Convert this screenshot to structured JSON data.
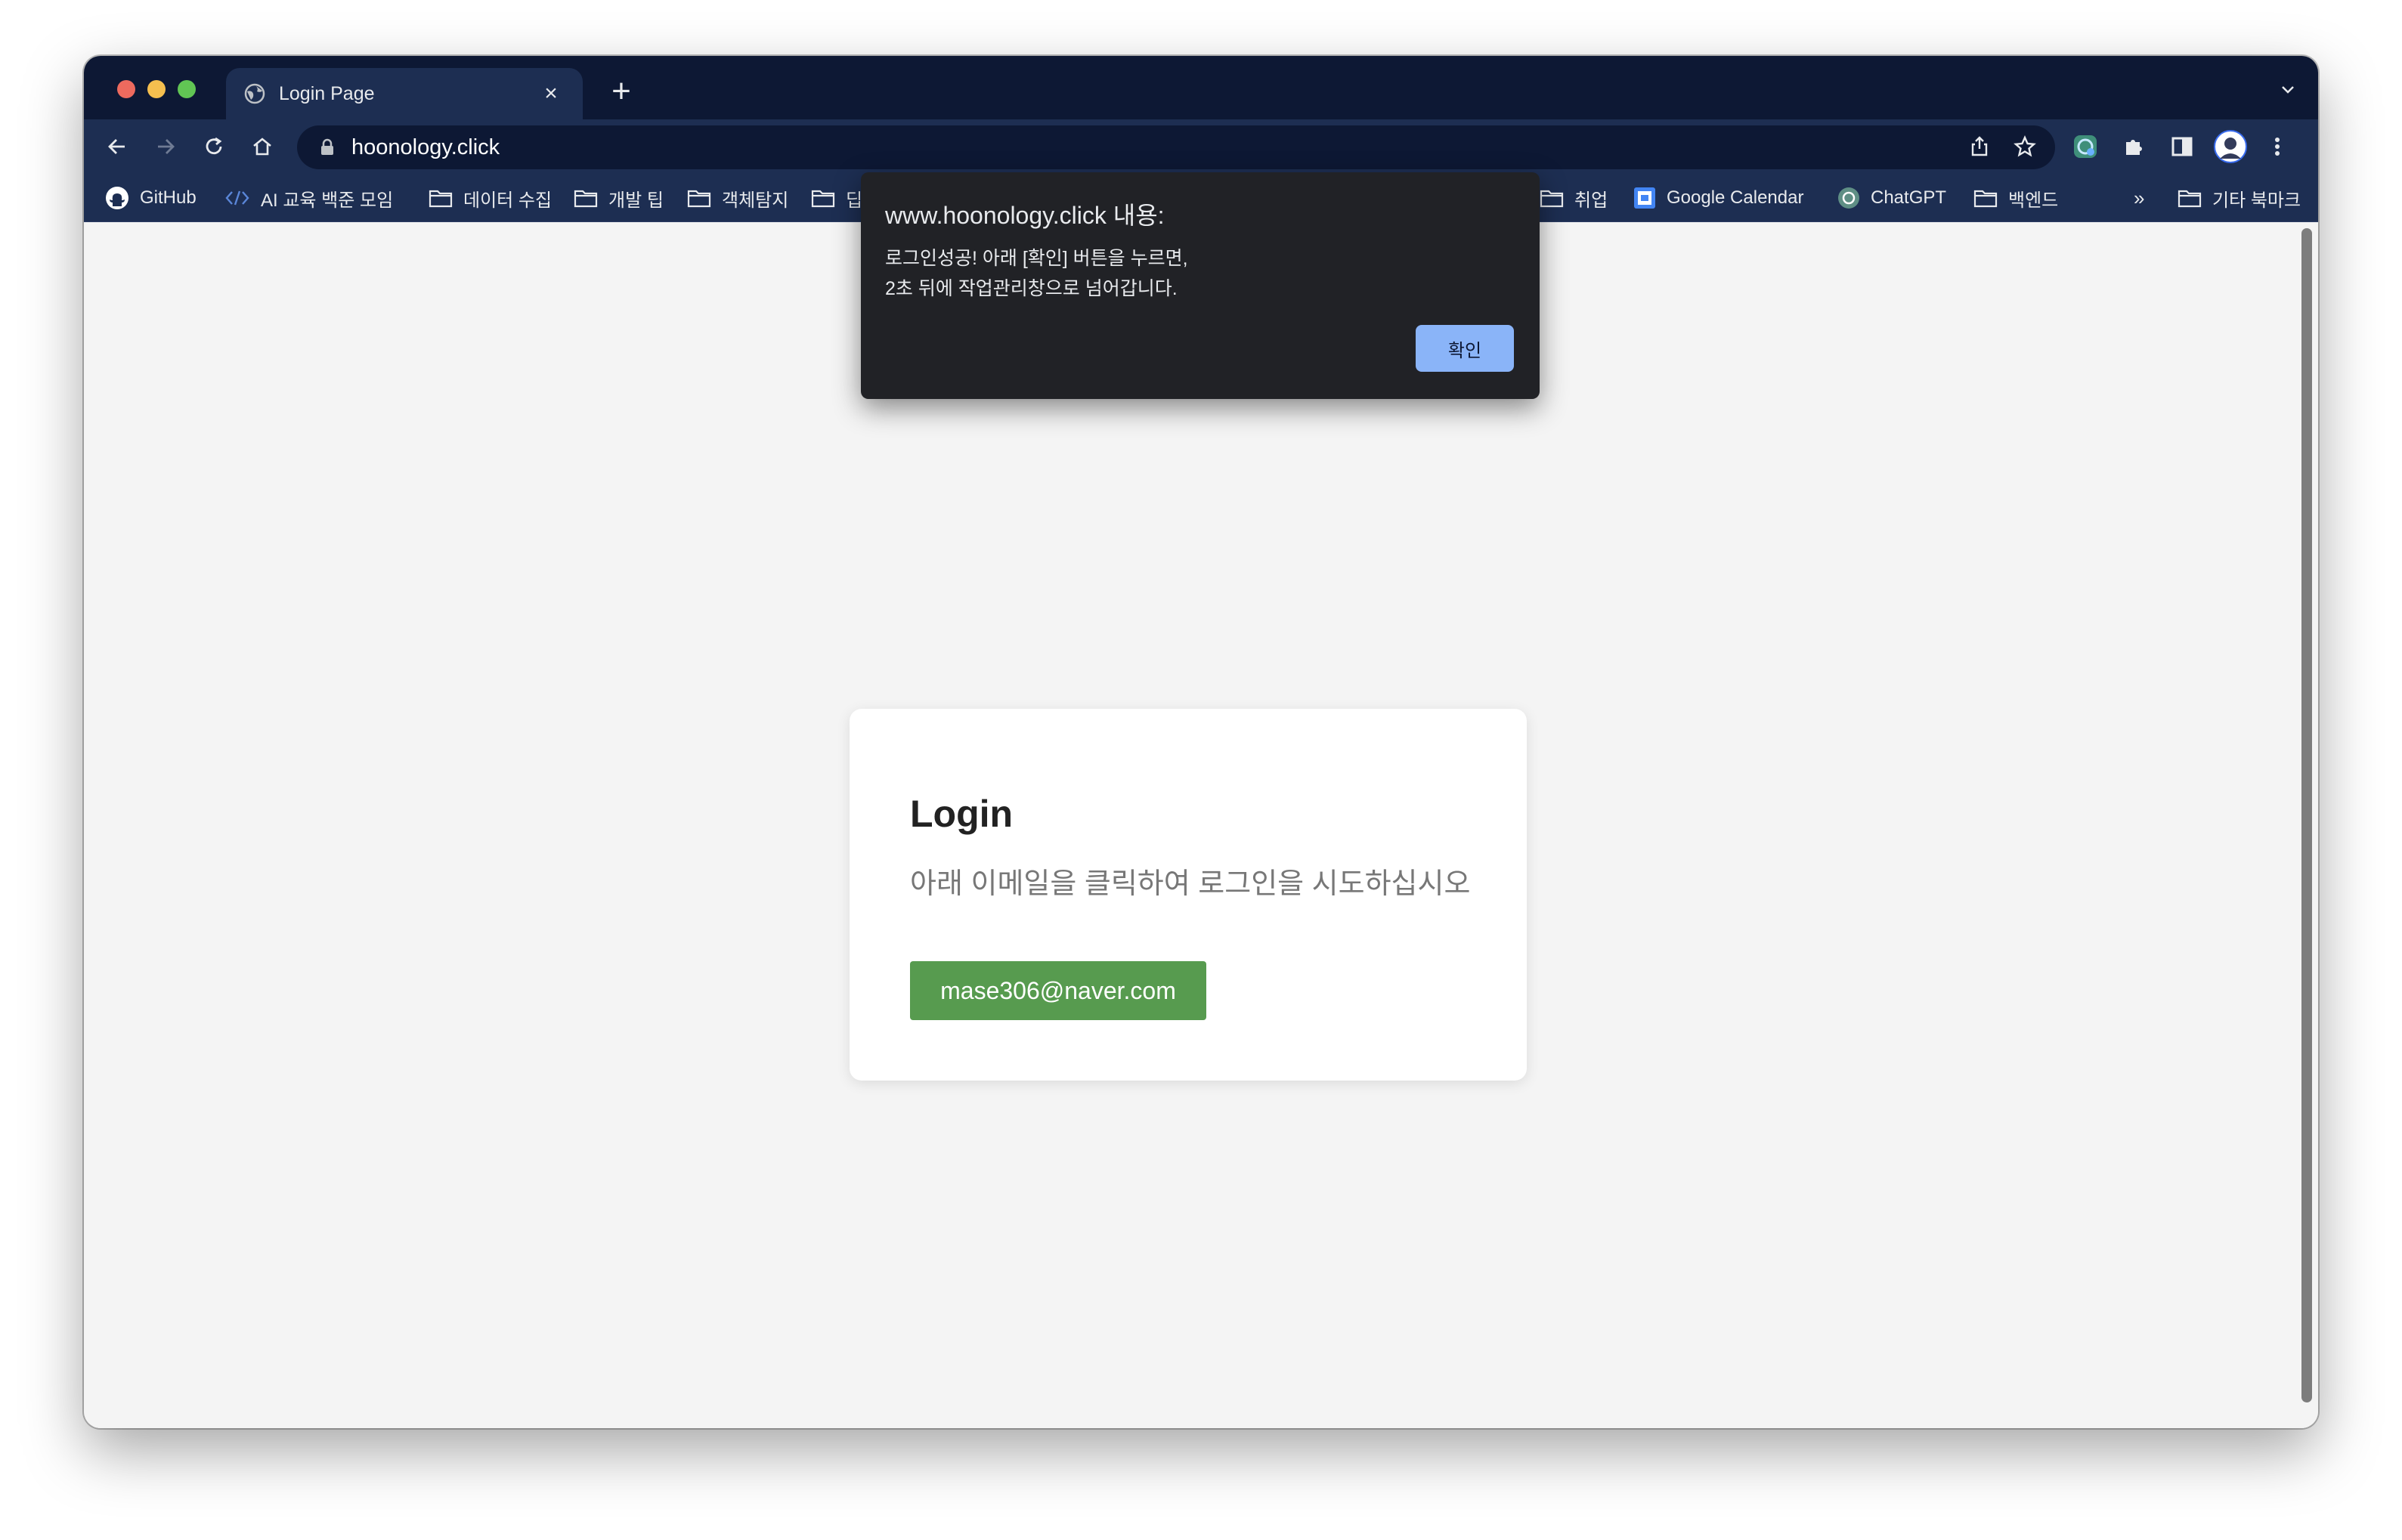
{
  "browser": {
    "tab": {
      "title": "Login Page",
      "close_glyph": "×",
      "icon": "globe-icon"
    },
    "new_tab_glyph": "+",
    "address": {
      "url": "hoonology.click",
      "icon": "lock-icon"
    },
    "overflow_glyph": "»",
    "bookmarks": [
      {
        "label": "GitHub",
        "icon": "github-icon"
      },
      {
        "label": "AI 교육 백준 모임 ",
        "icon": "code-icon"
      },
      {
        "label": "데이터 수집",
        "icon": "folder-icon"
      },
      {
        "label": "개발 팁",
        "icon": "folder-icon"
      },
      {
        "label": "객체탐지",
        "icon": "folder-icon"
      },
      {
        "label": "딥",
        "icon": "folder-icon"
      },
      {
        "label": "취업",
        "icon": "folder-icon"
      },
      {
        "label": "Google Calendar",
        "icon": "calendar-icon"
      },
      {
        "label": "ChatGPT",
        "icon": "chatgpt-icon"
      },
      {
        "label": "백엔드",
        "icon": "folder-icon"
      },
      {
        "label": "기타 북마크",
        "icon": "folder-icon"
      }
    ]
  },
  "dialog": {
    "title": "www.hoonology.click 내용:",
    "message_line1": "로그인성공! 아래 [확인] 버튼을 누르면,",
    "message_line2": "2초 뒤에 작업관리창으로 넘어갑니다.",
    "ok_label": "확인"
  },
  "login": {
    "title": "Login",
    "subtitle": "아래 이메일을 클릭하여 로그인을 시도하십시오",
    "email_button": "mase306@naver.com"
  },
  "colors": {
    "titlebar": "#0d1834",
    "toolbar": "#1d2e52",
    "dialog_bg": "#212226",
    "dialog_button": "#8ab4f8",
    "email_button": "#579b4f",
    "page_bg": "#f4f4f4"
  }
}
